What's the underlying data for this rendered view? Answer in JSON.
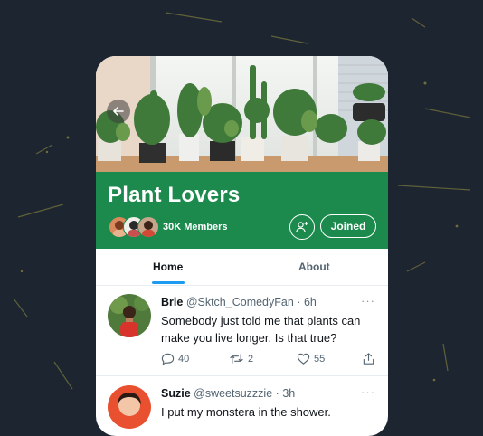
{
  "community": {
    "name": "Plant Lovers",
    "members_label": "30K Members",
    "joined_label": "Joined",
    "accent_color": "#1b8a4c"
  },
  "tabs": [
    {
      "label": "Home",
      "active": true
    },
    {
      "label": "About",
      "active": false
    }
  ],
  "icons": {
    "back": "arrow-left-icon",
    "add_member": "person-plus-icon",
    "more": "more-horizontal-icon",
    "reply": "comment-icon",
    "retweet": "retweet-icon",
    "like": "heart-icon",
    "share": "share-icon"
  },
  "tweets": [
    {
      "name": "Brie",
      "handle": "@Sktch_ComedyFan",
      "dot": "·",
      "time": "6h",
      "more": "···",
      "text": "Somebody just told me that plants can make you live longer. Is that true?",
      "replies": "40",
      "retweets": "2",
      "likes": "55"
    },
    {
      "name": "Suzie",
      "handle": "@sweetsuzzzie",
      "dot": "·",
      "time": "3h",
      "more": "···",
      "text": "I put my monstera in the shower."
    }
  ]
}
